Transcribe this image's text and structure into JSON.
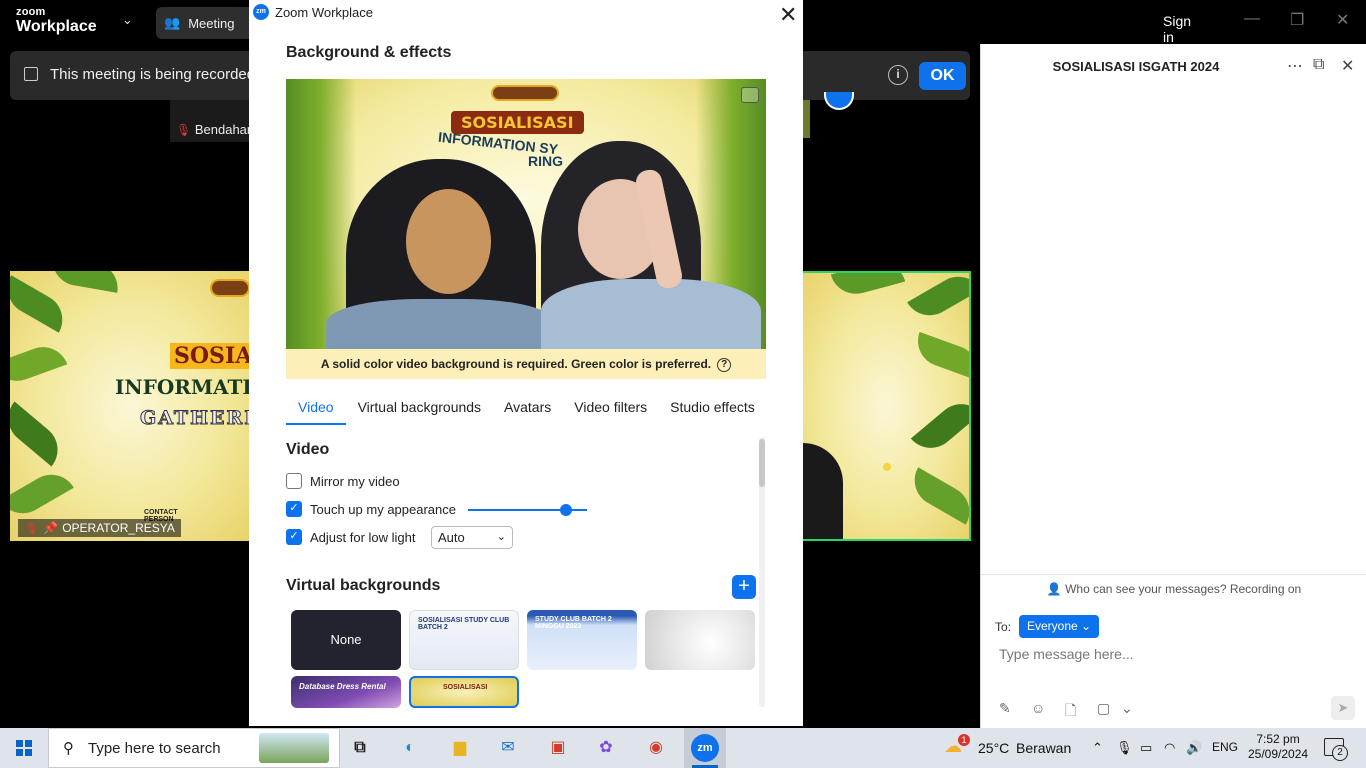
{
  "topbar": {
    "logo_small": "zoom",
    "logo_big": "Workplace",
    "meeting_label": "Meeting",
    "signin_label": "Sign in",
    "recording_banner": "This meeting is being recorded",
    "ok_label": "OK"
  },
  "tiles": {
    "top_cut_text": "Bendahara",
    "top_name": "Bendahar",
    "left_name": "OPERATOR_RESYA",
    "left_poster": [
      "SOSIA",
      "INFORMATI",
      "GATHERI"
    ],
    "left_contact": "CONTACT PERSON"
  },
  "dialog": {
    "window_title": "Zoom Workplace",
    "heading": "Background & effects",
    "preview_title": "SOSIALISASI",
    "preview_subtitle": "INFORMATION SY",
    "preview_subtitle2": "RING",
    "warning": "A solid color video background is required. Green color is preferred.",
    "tabs": [
      "Video",
      "Virtual backgrounds",
      "Avatars",
      "Video filters",
      "Studio effects"
    ],
    "active_tab": "Video",
    "video_section": "Video",
    "options": {
      "mirror": "Mirror my video",
      "touchup": "Touch up my appearance",
      "lowlight": "Adjust for low light"
    },
    "mirror_checked": false,
    "touchup_checked": true,
    "lowlight_checked": true,
    "touchup_level": 0.82,
    "lowlight_mode": "Auto",
    "vb_section": "Virtual backgrounds",
    "vb_items": {
      "none": "None",
      "item1": "SOSIALISASI STUDY CLUB BATCH 2",
      "item2": "STUDY CLUB BATCH 2 MINGGU 2023",
      "item3": "",
      "item4": "Database Dress Rental",
      "item5": "SOSIALISASI"
    }
  },
  "chat": {
    "title": "SOSIALISASI ISGATH 2024",
    "visibility": "Who can see your messages? Recording on",
    "to_label": "To:",
    "recipient": "Everyone",
    "placeholder": "Type message here..."
  },
  "taskbar": {
    "search_placeholder": "Type here to search",
    "weather_temp": "25°C",
    "weather_desc": "Berawan",
    "weather_badge": "1",
    "lang": "ENG",
    "time": "7:52 pm",
    "date": "25/09/2024",
    "notifications": "2"
  },
  "colors": {
    "accent": "#0e72ed",
    "warning_bg": "#fdefb8",
    "active_speaker": "#2bd56a"
  }
}
